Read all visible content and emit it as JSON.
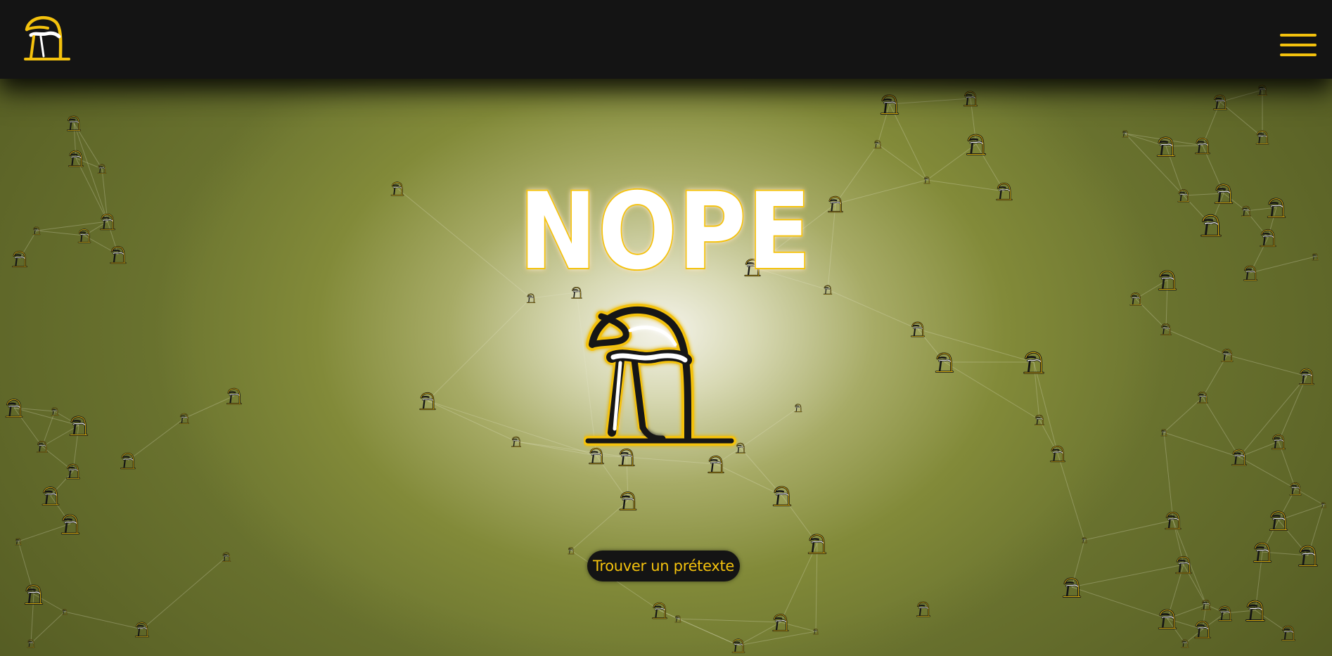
{
  "header": {
    "logo_icon": "ostrich-logo-icon",
    "menu_icon": "hamburger-menu-icon"
  },
  "hero": {
    "title": "NOPE",
    "mascot_icon": "ostrich-head-in-ground-icon",
    "cta_label": "Trouver un prétexte"
  },
  "colors": {
    "accent": "#f4c20d",
    "header_bg": "#141414",
    "background_center": "#f4f3ea",
    "background_edge": "#6c7530"
  }
}
